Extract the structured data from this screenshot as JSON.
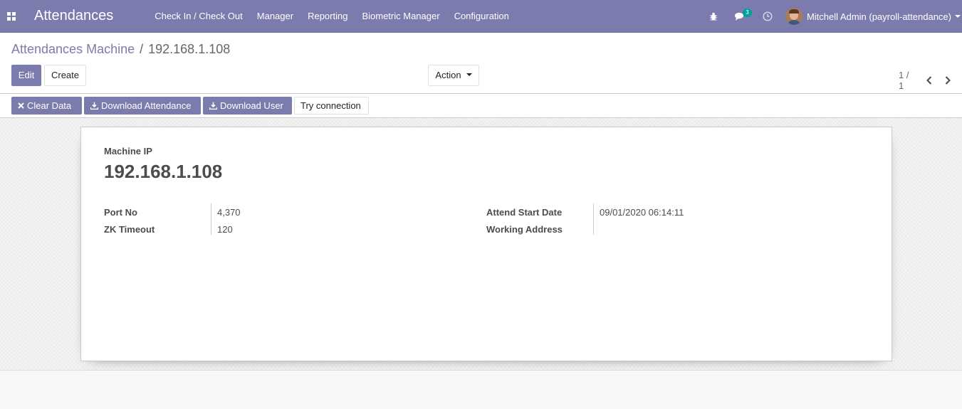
{
  "navbar": {
    "app_title": "Attendances",
    "menu": [
      "Check In / Check Out",
      "Manager",
      "Reporting",
      "Biometric Manager",
      "Configuration"
    ],
    "messages_count": "3",
    "user_name": "Mitchell Admin (payroll-attendance)",
    "bg_color": "#7c7bad"
  },
  "breadcrumb": {
    "parent": "Attendances Machine",
    "separator": "/",
    "current": "192.168.1.108"
  },
  "buttons": {
    "edit": "Edit",
    "create": "Create",
    "action": "Action"
  },
  "pager": {
    "text": "1 / 1"
  },
  "statusbar": {
    "clear_data": "Clear Data",
    "download_attendance": "Download Attendance",
    "download_user": "Download User",
    "try_connection": "Try connection"
  },
  "form": {
    "machine_ip_label": "Machine IP",
    "machine_ip": "192.168.1.108",
    "port_no_label": "Port No",
    "port_no": "4,370",
    "zk_timeout_label": "ZK Timeout",
    "zk_timeout": "120",
    "attend_start_date_label": "Attend Start Date",
    "attend_start_date": "09/01/2020 06:14:11",
    "working_address_label": "Working Address",
    "working_address": ""
  }
}
